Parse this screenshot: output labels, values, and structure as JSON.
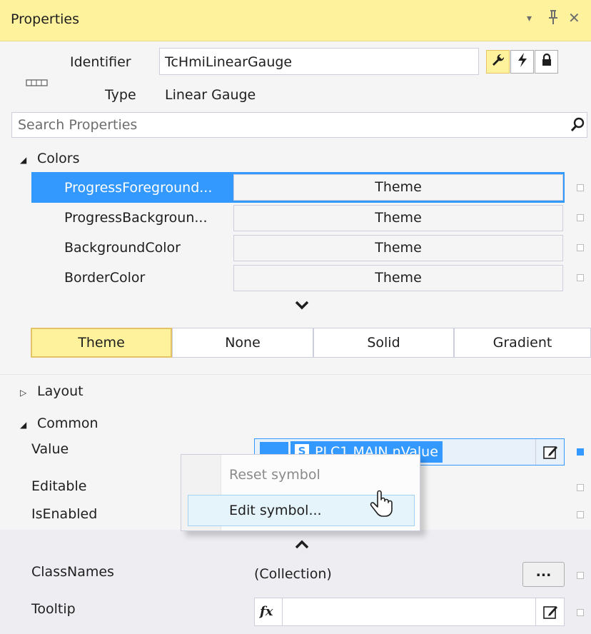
{
  "window": {
    "title": "Properties",
    "dropdown_glyph": "▾",
    "pin_glyph": "ᵖ",
    "close_glyph": "✕"
  },
  "header": {
    "identifier_label": "Identifier",
    "identifier_value": "TcHmiLinearGauge",
    "type_label": "Type",
    "type_value": "Linear Gauge",
    "search_placeholder": "Search Properties"
  },
  "categories": {
    "colors": {
      "arrow": "◢",
      "label": "Colors"
    },
    "layout": {
      "arrow": "▷",
      "label": "Layout"
    },
    "common": {
      "arrow": "◢",
      "label": "Common"
    }
  },
  "colors_props": [
    {
      "name": "ProgressForeground...",
      "value": "Theme",
      "selected": true
    },
    {
      "name": "ProgressBackgroun...",
      "value": "Theme",
      "selected": false
    },
    {
      "name": "BackgroundColor",
      "value": "Theme",
      "selected": false
    },
    {
      "name": "BorderColor",
      "value": "Theme",
      "selected": false
    }
  ],
  "color_modes": [
    "Theme",
    "None",
    "Solid",
    "Gradient"
  ],
  "common_props": {
    "value_label": "Value",
    "value_symbol_badge": "S",
    "value_symbol": "PLC1.MAIN.nValue",
    "editable_label": "Editable",
    "isenabled_label": "IsEnabled",
    "classnames_label": "ClassNames",
    "classnames_value": "(Collection)",
    "classnames_button": "...",
    "tooltip_label": "Tooltip",
    "tooltip_fx": "fx"
  },
  "context_menu": {
    "items": [
      {
        "label": "Reset symbol",
        "enabled": false
      },
      {
        "label": "Edit symbol...",
        "enabled": true
      }
    ]
  },
  "colors": {
    "accent": "#3399ff",
    "highlight_yellow": "#fff29d",
    "panel_bg": "#f5f5f5"
  }
}
